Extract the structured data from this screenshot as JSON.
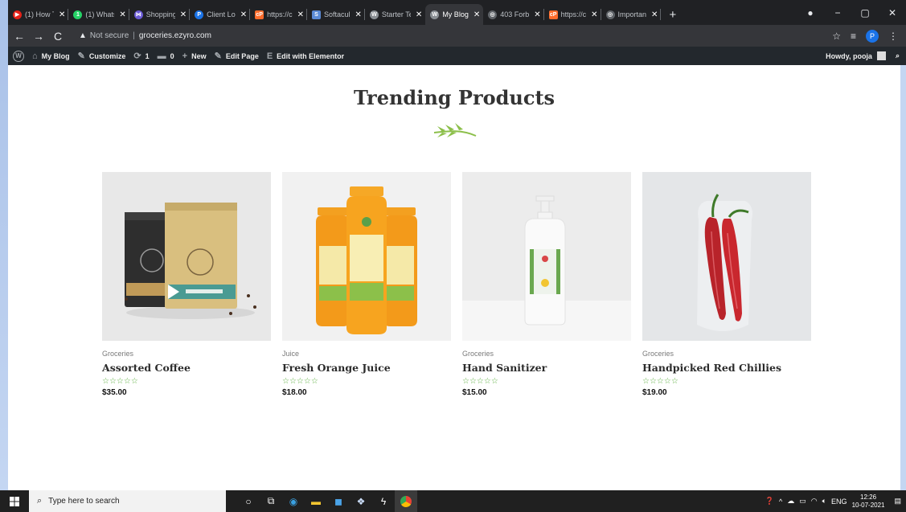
{
  "browser": {
    "tabs": [
      {
        "title": "(1) How T",
        "fav_color": "#e62117",
        "fav_glyph": "▶"
      },
      {
        "title": "(1) Whats",
        "fav_color": "#25d366",
        "fav_glyph": "1"
      },
      {
        "title": "Shopping",
        "fav_color": "#6b5bd6",
        "fav_glyph": "⋈"
      },
      {
        "title": "Client Lo",
        "fav_color": "#1a73e8",
        "fav_glyph": "P"
      },
      {
        "title": "https://c",
        "fav_color": "#ff6c2c",
        "fav_glyph": "cP"
      },
      {
        "title": "Softacul",
        "fav_color": "#5b8bd6",
        "fav_glyph": "S"
      },
      {
        "title": "Starter Te",
        "fav_color": "#8a8f94",
        "fav_glyph": "W"
      },
      {
        "title": "My Blog",
        "fav_color": "#8a8f94",
        "fav_glyph": "W"
      },
      {
        "title": "403 Forb",
        "fav_color": "#5f6368",
        "fav_glyph": "◎"
      },
      {
        "title": "https://c",
        "fav_color": "#ff6c2c",
        "fav_glyph": "cP"
      },
      {
        "title": "Importan",
        "fav_color": "#5f6368",
        "fav_glyph": "◎"
      }
    ],
    "active_tab_index": 7,
    "new_tab": "+",
    "window_controls": [
      "●",
      "−",
      "▢",
      "✕"
    ],
    "url_warning": "Not secure",
    "url": "groceries.ezyro.com",
    "profile_initial": "P"
  },
  "wp_admin_bar": {
    "items": [
      {
        "icon": "⌂",
        "label": "My Blog"
      },
      {
        "icon": "✎",
        "label": "Customize"
      },
      {
        "icon": "⟳",
        "label": "1"
      },
      {
        "icon": "▬",
        "label": "0"
      },
      {
        "icon": "+",
        "label": "New"
      },
      {
        "icon": "✎",
        "label": "Edit Page"
      },
      {
        "icon": "E",
        "label": "Edit with Elementor"
      }
    ],
    "greeting": "Howdy, pooja"
  },
  "section": {
    "title": "Trending Products"
  },
  "products": [
    {
      "category": "Groceries",
      "name": "Assorted Coffee",
      "rating": "☆☆☆☆☆",
      "price": "$35.00"
    },
    {
      "category": "Juice",
      "name": "Fresh Orange Juice",
      "rating": "☆☆☆☆☆",
      "price": "$18.00"
    },
    {
      "category": "Groceries",
      "name": "Hand Sanitizer",
      "rating": "☆☆☆☆☆",
      "price": "$15.00"
    },
    {
      "category": "Groceries",
      "name": "Handpicked Red Chillies",
      "rating": "☆☆☆☆☆",
      "price": "$19.00"
    }
  ],
  "taskbar": {
    "search_placeholder": "Type here to search",
    "language": "ENG",
    "time": "12:26",
    "date": "10-07-2021"
  }
}
